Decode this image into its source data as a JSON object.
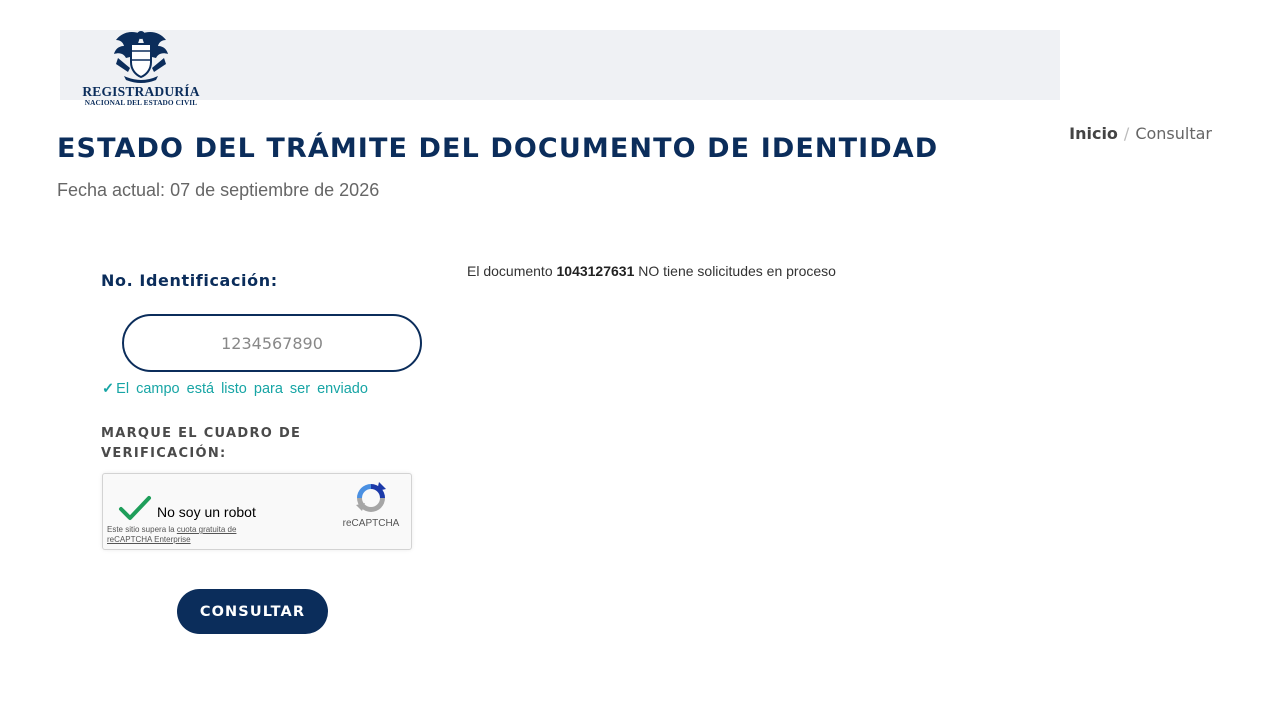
{
  "header": {
    "logo_title": "REGISTRADURÍA",
    "logo_subtitle": "NACIONAL DEL ESTADO CIVIL",
    "logo_icon": "coat-of-arms"
  },
  "breadcrumb": {
    "home": "Inicio",
    "separator": "/",
    "current": "Consultar"
  },
  "main": {
    "title": "ESTADO DEL TRÁMITE DEL DOCUMENTO DE IDENTIDAD",
    "date_text": "Fecha actual: 07 de septiembre de 2026"
  },
  "form": {
    "id_label": "No. Identificación:",
    "id_placeholder": "1234567890",
    "id_value": "",
    "valid_check": "✓",
    "valid_message": "El campo está listo para ser enviado",
    "captcha_heading": "MARQUE EL CUADRO DE VERIFICACIÓN:",
    "submit_label": "CONSULTAR"
  },
  "recaptcha": {
    "checkbox_label": "No soy un robot",
    "brand": "reCAPTCHA",
    "terms_prefix": "Este sitio supera la",
    "terms_link": "cuota gratuita de reCAPTCHA Enterprise",
    "checked": true
  },
  "result": {
    "prefix": "El documento",
    "document_number": "1043127631",
    "suffix": "NO tiene solicitudes en proceso"
  },
  "colors": {
    "brand_navy": "#0b2d5b",
    "valid_teal": "#17a5a5",
    "check_green": "#1e9e5a",
    "text_gray": "#666666"
  }
}
